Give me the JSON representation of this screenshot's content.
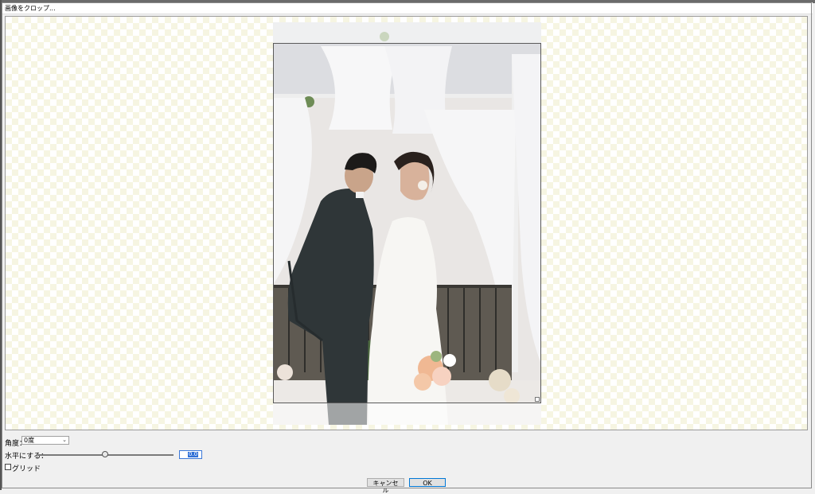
{
  "window": {
    "title": "画像をクロップ..."
  },
  "controls": {
    "angle_label": "角度：",
    "angle_value": "0度",
    "level_label": "水平にする：",
    "level_value": "0.0",
    "level_slider_fraction": 0.5,
    "grid_label": "グリッド",
    "grid_checked": false
  },
  "buttons": {
    "cancel": "キャンセル",
    "ok": "OK"
  },
  "colors": {
    "checker": "#f6f5e2",
    "focus_blue": "#0078d7",
    "selection": "#2f6fd6"
  }
}
